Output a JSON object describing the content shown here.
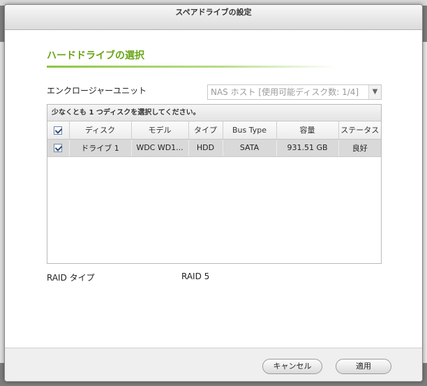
{
  "dialog": {
    "title": "スペアドライブの設定",
    "section_title": "ハードドライブの選択",
    "enclosure": {
      "label": "エンクロージャーユニット",
      "selected": "NAS ホスト [使用可能ディスク数: 1/4]"
    },
    "grid": {
      "caption": "少なくとも 1 つディスクを選択してください。",
      "header_checked": true,
      "columns": [
        "ディスク",
        "モデル",
        "タイプ",
        "Bus Type",
        "容量",
        "ステータス"
      ],
      "rows": [
        {
          "checked": true,
          "disk": "ドライブ 1",
          "model": "WDC WD1...",
          "type": "HDD",
          "bus_type": "SATA",
          "capacity": "931.51 GB",
          "status": "良好"
        }
      ]
    },
    "raid": {
      "label": "RAID タイプ",
      "value": "RAID 5"
    },
    "buttons": {
      "cancel": "キャンセル",
      "apply": "適用"
    }
  },
  "colors": {
    "accent_green": "#6aa517",
    "selected_row": "#d9d9d9"
  }
}
